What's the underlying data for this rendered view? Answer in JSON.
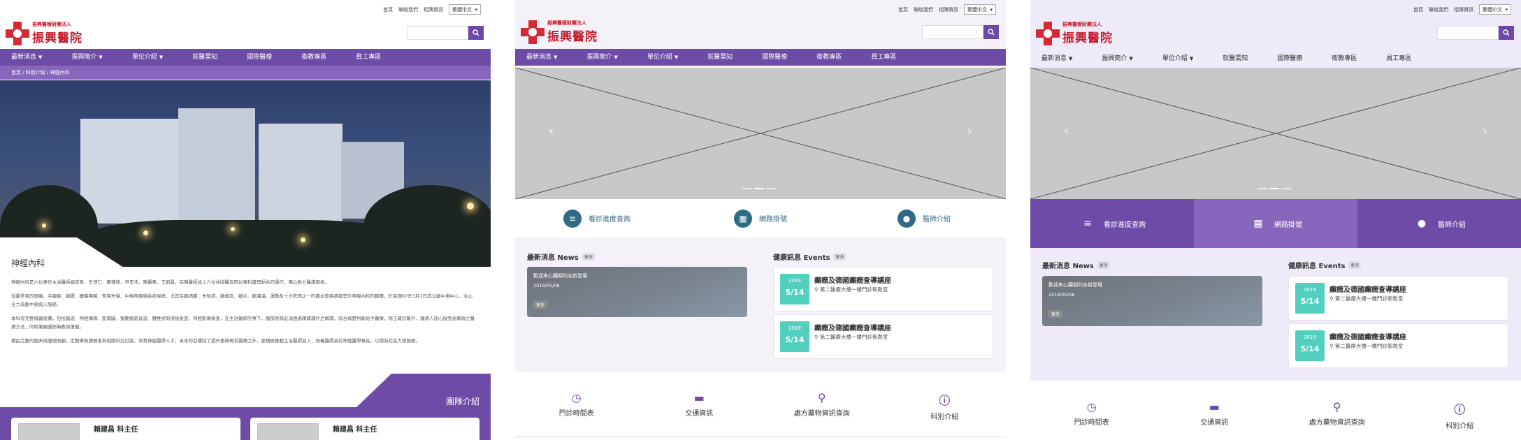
{
  "header": {
    "top_links": [
      "首頁",
      "聯絡我們",
      "相簿資訊"
    ],
    "language": "繁體中文",
    "logo_sub": "振興醫療財團法人",
    "logo_main": "振興醫院"
  },
  "nav": {
    "items": [
      {
        "label": "最新消息",
        "dropdown": true
      },
      {
        "label": "振興簡介",
        "dropdown": true
      },
      {
        "label": "單位介紹",
        "dropdown": true
      },
      {
        "label": "就醫需知",
        "dropdown": false
      },
      {
        "label": "國際醫療",
        "dropdown": false
      },
      {
        "label": "衛教專區",
        "dropdown": false
      },
      {
        "label": "員工專區",
        "dropdown": false
      }
    ]
  },
  "panel1": {
    "breadcrumb": "首頁 / 科別介紹 / 神經內科",
    "page_title": "神經內科",
    "paragraphs": [
      "神經內科是六位專任主治醫師組成員，王博仁、鄭禮德、尹思浩、陳麗萬、王凱鳳，在陳醫師加上六位住院醫及四位專科護理師共同運作，用心致力醫護兩者。",
      "從最常見的頭痛、手腳麻、腦震、睡眠障礙、暫時失憶、中樞神經感染症候群，尤其在腦病變、失智症、腦傷及、腦炎、腦灌溫、運動及十大死因之一的腦血管疾病都是診神經內科的範疇，於民國97年3月1日成立腦中風中心，全心全力為腦中風病人服務。",
      "本科有完整儀器設備，包括腦波、神經傳導、肌電圖、頸動脈超音波、腰椎穿刺液檢查室，神經影像檢查，在主治醫師診察下，腦部疾病必須透過精確讀片之解讀，綜合病歷判斷給予醫療，除正確診斷外，讓病人放心接受高療效之醫療方法，同時兼顧腦部衛教與復健。",
      "藉由完整的臨床與護理照顧，定期舉辦讀冊會與相關科別討論，培育神經醫學人才，未來的目標除了提升更新現有醫療之外，更積極推動主治醫師加入，培養醫師具有神經醫學專長，以期為社區大眾服務。"
    ],
    "team_label": "團隊介紹",
    "doctors": [
      "賴建昌 科主任",
      "賴建昌 科主任"
    ]
  },
  "home": {
    "quick_links": [
      {
        "label": "看診進度查詢",
        "icon": "list-icon"
      },
      {
        "label": "網路掛號",
        "icon": "calendar-icon"
      },
      {
        "label": "醫師介紹",
        "icon": "user-icon"
      }
    ],
    "news": {
      "heading": "最新消息 News",
      "more": "更多",
      "item_title": "歡迎來心臟期刊全新登場",
      "item_date": "2019/05/06",
      "item_more": "更多"
    },
    "events": {
      "heading": "健康訊息 Events",
      "more": "更多",
      "items": [
        {
          "year": "2019",
          "date": "5/14",
          "title": "癲癇及德國癲癇查導講座",
          "location": "第二醫療大樓一樓門診衛教室"
        },
        {
          "year": "2019",
          "date": "5/14",
          "title": "癲癇及德國癲癇查導講座",
          "location": "第二醫療大樓一樓門診衛教室"
        }
      ]
    },
    "bottom_links": [
      {
        "label": "門診時間表",
        "icon": "clock-icon"
      },
      {
        "label": "交通資訊",
        "icon": "car-icon"
      },
      {
        "label": "處方藥物資訊查詢",
        "icon": "search-icon"
      },
      {
        "label": "科別介紹",
        "icon": "info-icon"
      }
    ]
  },
  "colors": {
    "brand_purple": "#6e4ba6",
    "light_purple": "#8766bc",
    "logo_red": "#d42a36",
    "teal": "#53cfc0",
    "quick_blue": "#2f6b86"
  }
}
